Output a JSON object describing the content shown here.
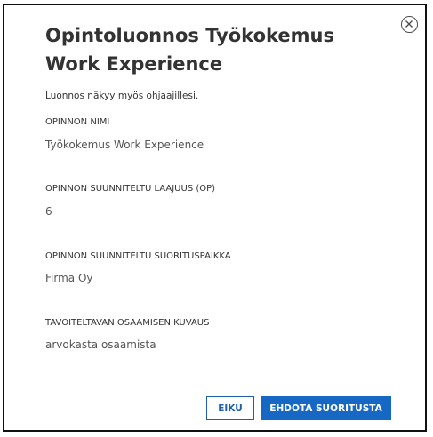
{
  "dialog": {
    "title": "Opintoluonnos Työkokemus Work Experience",
    "note": "Luonnos näkyy myös ohjaajillesi.",
    "close_icon": "close-circle-icon",
    "fields": [
      {
        "label": "OPINNON NIMI",
        "value": "Työkokemus Work Experience"
      },
      {
        "label": "OPINNON SUUNNITELTU LAAJUUS (OP)",
        "value": "6"
      },
      {
        "label": "OPINNON SUUNNITELTU SUORITUSPAIKKA",
        "value": "Firma Oy"
      },
      {
        "label": "TAVOITELTAVAN OSAAMISEN KUVAUS",
        "value": "arvokasta osaamista"
      }
    ],
    "buttons": {
      "cancel_label": "EIKU",
      "submit_label": "EHDOTA SUORITUSTA"
    },
    "colors": {
      "primary": "#1668c4",
      "text": "#333333",
      "border": "#111111"
    }
  }
}
